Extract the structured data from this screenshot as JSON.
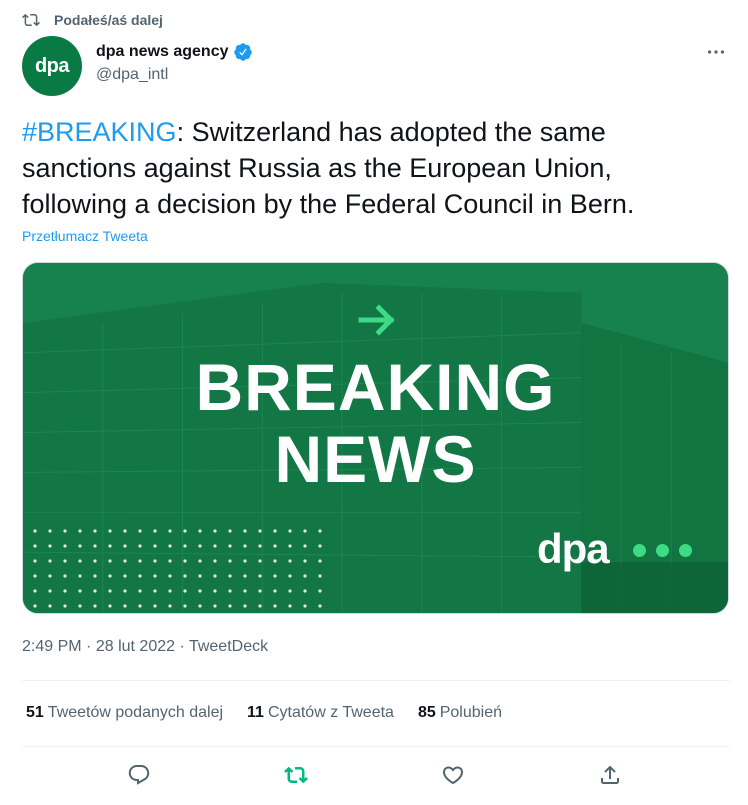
{
  "retweet_context": {
    "label": "Podałeś/aś dalej",
    "icon": "retweet-icon"
  },
  "author": {
    "avatar_text": "dpa",
    "display_name": "dpa news agency",
    "handle": "@dpa_intl",
    "verified": true,
    "avatar_color": "#0a7a45"
  },
  "tweet": {
    "hashtag": "#BREAKING",
    "text": ": Switzerland has adopted the same sanctions against Russia as the European Union, following a decision by the Federal Council in Bern.",
    "translate_label": "Przetłumacz Tweeta"
  },
  "media": {
    "headline_line1": "BREAKING",
    "headline_line2": "NEWS",
    "brand": "dpa",
    "background_color": "#1b8a52",
    "accent_color": "#3ddc84"
  },
  "meta": {
    "time": "2:49 PM",
    "date": "28 lut 2022",
    "source": "TweetDeck",
    "separator": "·"
  },
  "stats": {
    "retweets": {
      "count": "51",
      "label": "Tweetów podanych dalej"
    },
    "quotes": {
      "count": "11",
      "label": "Cytatów z Tweeta"
    },
    "likes": {
      "count": "85",
      "label": "Polubień"
    }
  },
  "actions": [
    "reply-icon",
    "retweet-icon",
    "like-icon",
    "share-icon"
  ],
  "colors": {
    "link": "#1d9bf0",
    "muted": "#536471",
    "retweeted": "#00ba7c"
  }
}
